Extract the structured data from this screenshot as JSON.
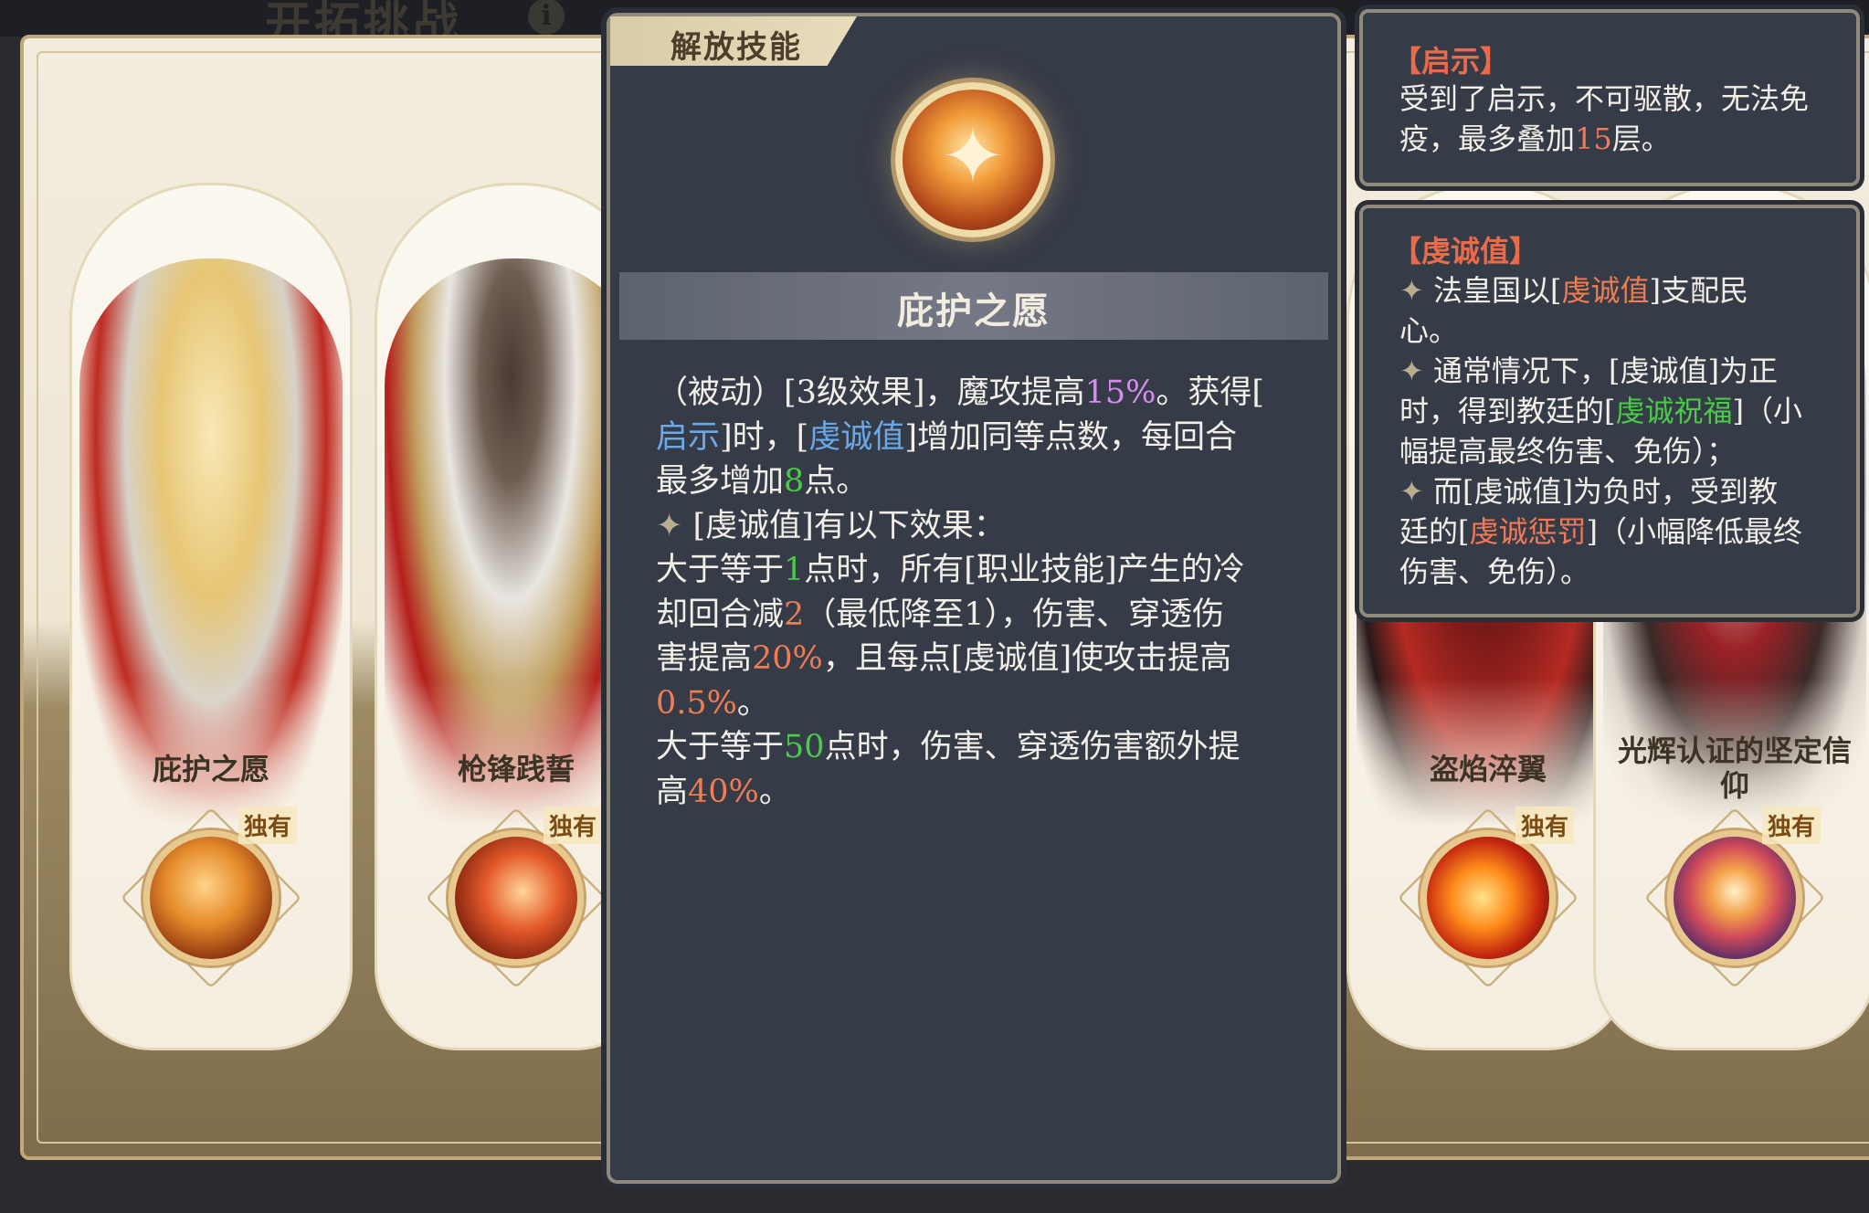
{
  "header": {
    "title": "开拓挑战",
    "info_icon": "i"
  },
  "cards": [
    {
      "name": "庇护之愿",
      "exclusive": "独有",
      "portrait_colors": [
        "#f1d58a",
        "#c2211c",
        "#f4f1ea"
      ]
    },
    {
      "name": "枪锋践誓",
      "exclusive": "独有",
      "portrait_colors": [
        "#3b2f2a",
        "#b81d1a",
        "#e9e8e6"
      ]
    },
    {
      "name": "盗焰淬翼",
      "exclusive": "独有",
      "portrait_colors": [
        "#5a1412",
        "#b82621",
        "#1f1414"
      ]
    },
    {
      "name_line1": "光辉认证的坚定信",
      "name_line2": "仰",
      "exclusive": "独有",
      "portrait_colors": [
        "#8c1a20",
        "#f2efe9",
        "#3d2e2a"
      ]
    }
  ],
  "panel": {
    "tab": "解放技能",
    "skill_name": "庇护之愿",
    "lines": [
      [
        "（被动）[3级效果]，魔攻提高",
        "15%",
        "。获得["
      ],
      [
        "启示",
        "]时，[",
        "虔诚值",
        "]增加同等点数，每回合"
      ],
      [
        "最多增加",
        "8",
        "点。"
      ],
      [
        "[虔诚值]有以下效果："
      ],
      [
        "大于等于",
        "1",
        "点时，所有[职业技能]产生的冷"
      ],
      [
        "却回合减",
        "2",
        "（最低降至1），伤害、穿透伤"
      ],
      [
        "害提高",
        "20%",
        "，且每点[虔诚值]使攻击提高"
      ],
      [
        "0.5%",
        "。"
      ],
      [
        "大于等于",
        "50",
        "点时，伤害、穿透伤害额外提"
      ],
      [
        "高",
        "40%",
        "。"
      ]
    ]
  },
  "tip_revelation": {
    "head": "【启示】",
    "lines": [
      [
        "受到了启示，不可驱散，无法免"
      ],
      [
        "疫，最多叠加",
        "15",
        "层。"
      ]
    ]
  },
  "tip_piety": {
    "head": "【虔诚值】",
    "lines": [
      [
        "法皇国以[",
        "虔诚值",
        "]支配民"
      ],
      [
        "心。"
      ],
      [
        "通常情况下，[虔诚值]为正"
      ],
      [
        "时，得到教廷的[",
        "虔诚祝福",
        "]（小"
      ],
      [
        "幅提高最终伤害、免伤）；"
      ],
      [
        "而[虔诚值]为负时，受到教"
      ],
      [
        "廷的[",
        "虔诚惩罚",
        "]（小幅降低最终"
      ],
      [
        "伤害、免伤）。"
      ]
    ]
  },
  "colors": {
    "panel_bg": "#363b48",
    "highlight_purple": "#d58cf0",
    "highlight_blue": "#6aa9e8",
    "highlight_green": "#4cc84a",
    "highlight_orange": "#ee7d53",
    "tip_head": "#e96b4a"
  },
  "icons": {
    "star": "four-point-star-icon",
    "emblem": "holy-relic-icon",
    "info": "info-icon"
  }
}
